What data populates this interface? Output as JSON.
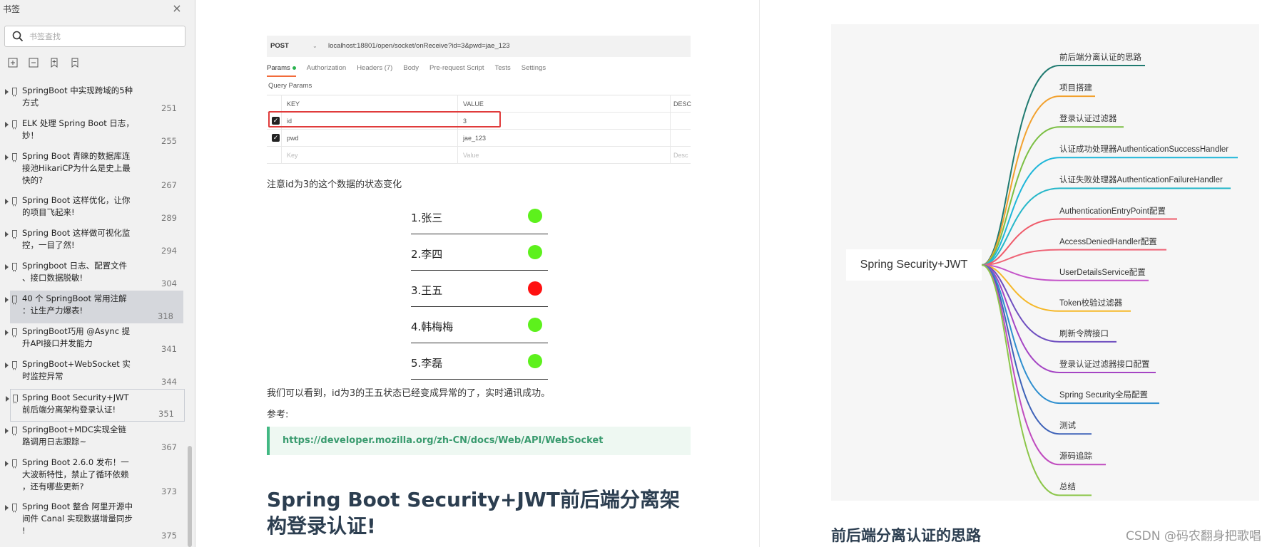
{
  "sidebar": {
    "title": "书签",
    "search_placeholder": "书签查找",
    "items": [
      {
        "label": "SpringBoot 中实现跨域的5种\n方式",
        "page": "251"
      },
      {
        "label": "ELK 处理 Spring Boot 日志，\n妙！",
        "page": "255"
      },
      {
        "label": "Spring Boot 青睐的数据库连\n接池HikariCP为什么是史上最\n快的?",
        "page": "267"
      },
      {
        "label": "Spring Boot 这样优化，让你\n的项目飞起来!",
        "page": "289"
      },
      {
        "label": "Spring Boot 这样做可视化监\n控，一目了然!",
        "page": "294"
      },
      {
        "label": "Springboot 日志、配置文件\n、接口数据脱敏!",
        "page": "304"
      },
      {
        "label": "40 个 SpringBoot 常用注解\n：让生产力爆表!",
        "page": "318"
      },
      {
        "label": "SpringBoot巧用 @Async 提\n升API接口并发能力",
        "page": "341"
      },
      {
        "label": "SpringBoot+WebSocket 实\n时监控异常",
        "page": "344"
      },
      {
        "label": "Spring Boot Security+JWT\n前后端分离架构登录认证!",
        "page": "351"
      },
      {
        "label": "SpringBoot+MDC实现全链\n路调用日志跟踪~",
        "page": "367"
      },
      {
        "label": "Spring Boot 2.6.0 发布！一\n大波新特性，禁止了循环依赖\n，还有哪些更新?",
        "page": "373"
      },
      {
        "label": "Spring Boot 整合 阿里开源中\n间件 Canal 实现数据增量同步\n!",
        "page": "375"
      }
    ]
  },
  "postman": {
    "method": "POST",
    "url": "localhost:18801/open/socket/onReceive?id=3&pwd=jae_123",
    "tabs": [
      "Params",
      "Authorization",
      "Headers (7)",
      "Body",
      "Pre-request Script",
      "Tests",
      "Settings"
    ],
    "query_params_label": "Query Params",
    "headers": {
      "key": "KEY",
      "value": "VALUE",
      "desc": "DESC"
    },
    "rows": [
      {
        "key": "id",
        "value": "3"
      },
      {
        "key": "pwd",
        "value": "jae_123"
      },
      {
        "key": "Key",
        "value": "Value",
        "desc": "Desc"
      }
    ]
  },
  "doc_left": {
    "note": "注意id为3的这个数据的状态变化",
    "status_items": [
      {
        "name": "1.张三",
        "status": "normal"
      },
      {
        "name": "2.李四",
        "status": "normal"
      },
      {
        "name": "3.王五",
        "status": "abnormal"
      },
      {
        "name": "4.韩梅梅",
        "status": "normal"
      },
      {
        "name": "5.李磊",
        "status": "normal"
      }
    ],
    "conclusion": "我们可以看到，id为3的王五状态已经变成异常的了，实时通讯成功。",
    "reference_label": "参考:",
    "reference_link": "https://developer.mozilla.org/zh-CN/docs/Web/API/WebSocket",
    "heading": "Spring Boot Security+JWT前后端分离架构登录认证!"
  },
  "colors": {
    "normal": "#5df11c",
    "abnormal": "#ff1111",
    "link": "#3a9b6f",
    "heading": "#2c3e50"
  },
  "mindmap": {
    "root": "Spring Security+JWT",
    "branches": [
      {
        "label": "前后端分离认证的思路",
        "color": "#1f7a70"
      },
      {
        "label": "项目搭建",
        "color": "#f2a12e"
      },
      {
        "label": "登录认证过滤器",
        "color": "#7bbf43"
      },
      {
        "label": "认证成功处理器AuthenticationSuccessHandler",
        "color": "#1eb6d9"
      },
      {
        "label": "认证失败处理器AuthenticationFailureHandler",
        "color": "#27b7c9"
      },
      {
        "label": "AuthenticationEntryPoint配置",
        "color": "#ef5b6a"
      },
      {
        "label": "AccessDeniedHandler配置",
        "color": "#ee6476"
      },
      {
        "label": "UserDetailsService配置",
        "color": "#c454c9"
      },
      {
        "label": "Token校验过滤器",
        "color": "#f5b829"
      },
      {
        "label": "刷新令牌接口",
        "color": "#6f4fc0"
      },
      {
        "label": "登录认证过滤器接口配置",
        "color": "#a545c4"
      },
      {
        "label": "Spring Security全局配置",
        "color": "#2f8fcf"
      },
      {
        "label": "测试",
        "color": "#3e62b8"
      },
      {
        "label": "源码追踪",
        "color": "#c04cbf"
      },
      {
        "label": "总结",
        "color": "#8cc64a"
      }
    ]
  },
  "doc_right": {
    "heading": "前后端分离认证的思路"
  },
  "watermark": "CSDN @码农翻身把歌唱"
}
